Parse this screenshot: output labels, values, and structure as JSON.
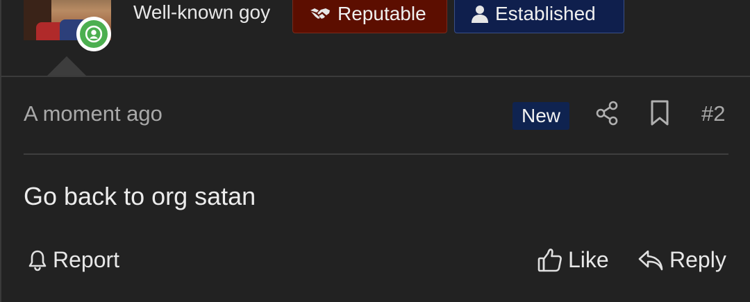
{
  "user": {
    "title": "Well-known goy",
    "online_icon": "user-online-icon",
    "badges": [
      {
        "label": "Reputable",
        "icon": "handshake-icon",
        "color": "#5c0e00"
      },
      {
        "label": "Established",
        "icon": "user-icon",
        "color": "#0f1f4d"
      }
    ]
  },
  "post": {
    "time": "A moment ago",
    "new_label": "New",
    "number": "#2",
    "message": "Go back to org satan"
  },
  "actions": {
    "report": "Report",
    "like": "Like",
    "reply": "Reply"
  },
  "colors": {
    "background": "#222222",
    "online": "#4caf50"
  }
}
